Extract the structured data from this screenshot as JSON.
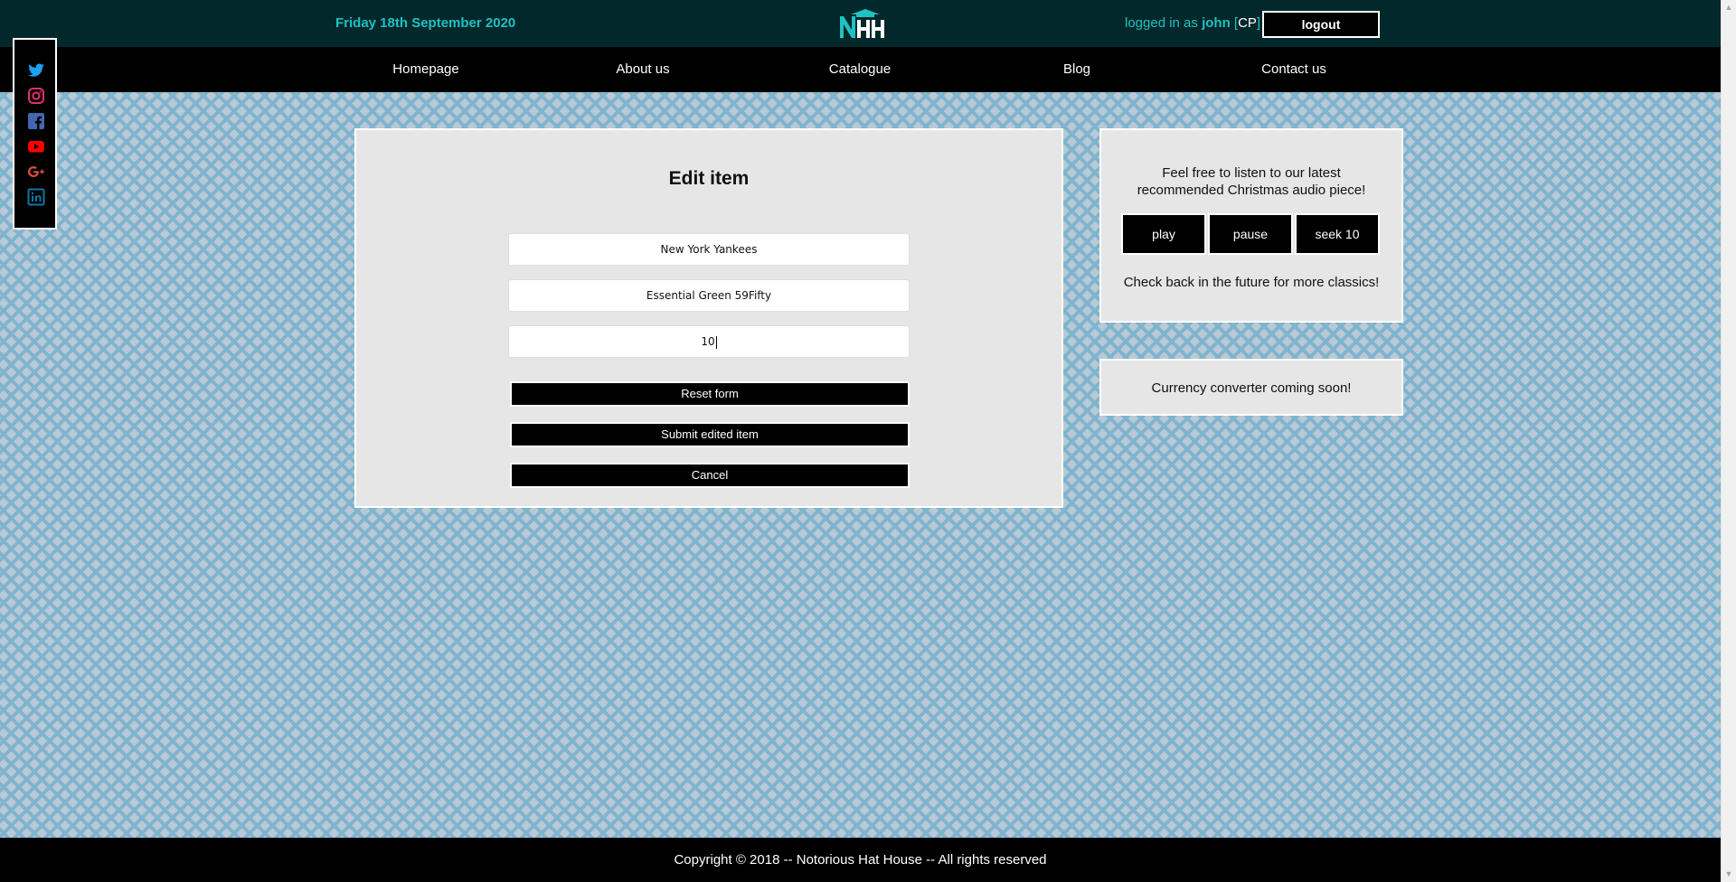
{
  "header": {
    "date": "Friday 18th September 2020",
    "logo_text": "NHH",
    "logged_in_prefix": "logged in as",
    "username": "john",
    "cp_link": "CP",
    "logout_label": "logout"
  },
  "nav": {
    "items": [
      {
        "label": "Homepage"
      },
      {
        "label": "About us"
      },
      {
        "label": "Catalogue"
      },
      {
        "label": "Blog"
      },
      {
        "label": "Contact us"
      }
    ]
  },
  "social": {
    "icons": [
      "twitter-icon",
      "instagram-icon",
      "facebook-icon",
      "youtube-icon",
      "google-plus-icon",
      "linkedin-icon"
    ]
  },
  "edit_form": {
    "title": "Edit item",
    "fields": {
      "team": "New York Yankees",
      "name": "Essential Green 59Fifty",
      "quantity": "10"
    },
    "reset_label": "Reset form",
    "submit_label": "Submit edited item",
    "cancel_label": "Cancel"
  },
  "audio": {
    "message": "Feel free to listen to our latest recommended Christmas audio piece!",
    "play_label": "play",
    "pause_label": "pause",
    "seek_label": "seek 10",
    "footer_message": "Check back in the future for more classics!"
  },
  "currency": {
    "message": "Currency converter coming soon!"
  },
  "footer": {
    "copyright": "Copyright © 2018 -- Notorious Hat House -- All rights reserved"
  },
  "colors": {
    "accent": "#1fc1c1",
    "topbar": "#03282b",
    "nav": "#000000",
    "panel": "#e6e6e6"
  }
}
